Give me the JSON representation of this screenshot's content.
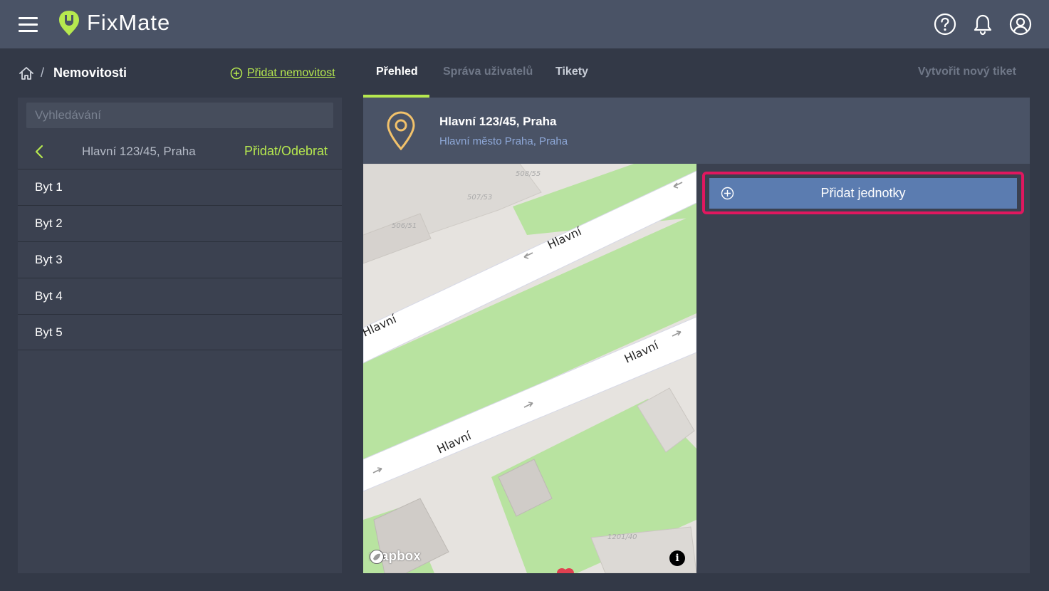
{
  "app": {
    "name": "FixMate",
    "brand_color": "#b6e84f",
    "header_bg": "#4a5366",
    "accent_highlight": "#e0175f"
  },
  "topbar_icons": [
    "menu-icon",
    "help-icon",
    "bell-icon",
    "user-icon"
  ],
  "breadcrumb": {
    "separator": "/",
    "current": "Nemovitosti"
  },
  "actions": {
    "add_property": "Přidat nemovitost",
    "new_ticket": "Vytvořit nový tiket"
  },
  "tabs": [
    {
      "label": "Přehled",
      "active": true
    },
    {
      "label": "Správa uživatelů",
      "active": false
    },
    {
      "label": "Tikety",
      "active": false
    }
  ],
  "sidebar": {
    "search_placeholder": "Vyhledávání",
    "nav_title": "Hlavní 123/45, Praha",
    "nav_action": "Přidat/Odebrat",
    "units": [
      "Byt 1",
      "Byt 2",
      "Byt 3",
      "Byt 4",
      "Byt 5"
    ]
  },
  "property": {
    "title": "Hlavní 123/45, Praha",
    "subtitle": "Hlavní město Praha, Praha"
  },
  "map": {
    "street_labels": [
      "Hlavní",
      "Hlavní",
      "Hlavní",
      "Hlavní"
    ],
    "building_numbers": [
      "508/55",
      "507/53",
      "506/51",
      "1201/40"
    ],
    "attribution": "mapbox",
    "info_label": "i"
  },
  "add_units_button": "Přidat jednotky"
}
